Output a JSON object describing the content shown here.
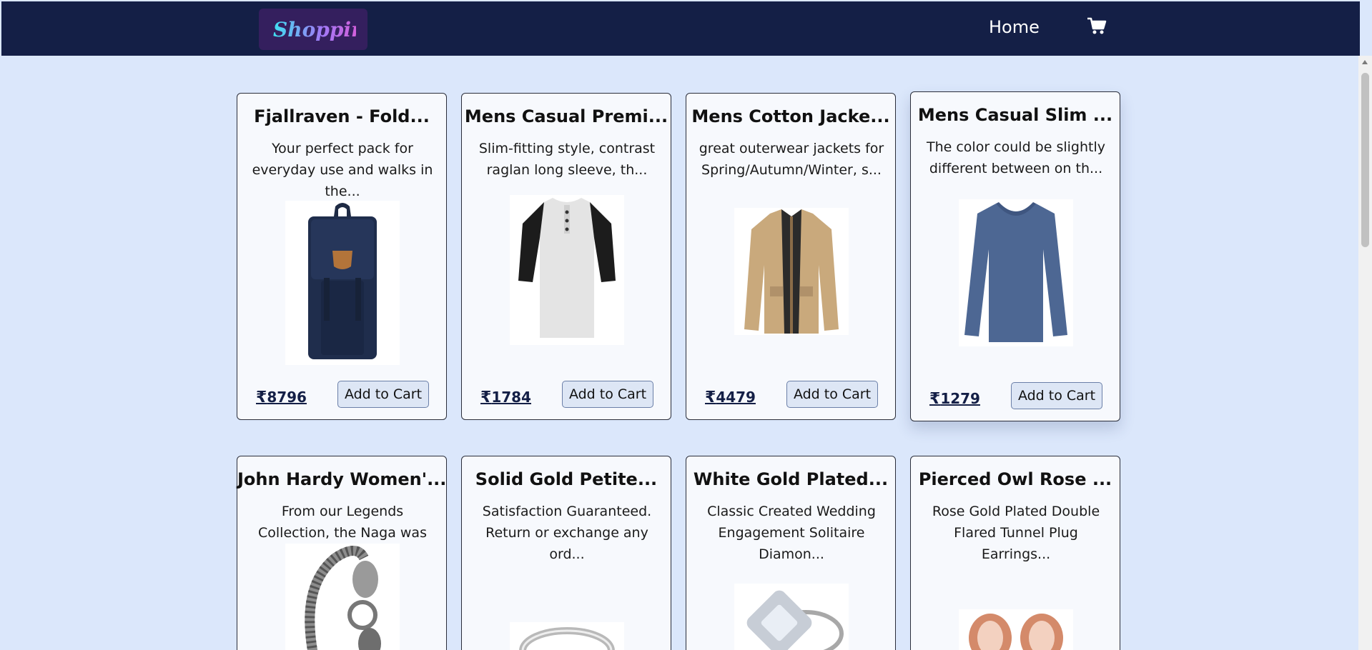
{
  "navbar": {
    "logo_text": "Shopping",
    "home_label": "Home",
    "cart_icon": "shopping-cart-icon",
    "background": "#141f46"
  },
  "products": [
    {
      "title": "Fjallraven - Fold...",
      "description": "Your perfect pack for everyday use and walks in the...",
      "price": "8796",
      "currency": "₹",
      "button": "Add to Cart",
      "icon": "backpack-image"
    },
    {
      "title": "Mens Casual Premi...",
      "description": "Slim-fitting style, contrast raglan long sleeve, th...",
      "price": "1784",
      "currency": "₹",
      "button": "Add to Cart",
      "icon": "raglan-tshirt-image"
    },
    {
      "title": "Mens Cotton Jacke...",
      "description": "great outerwear jackets for Spring/Autumn/Winter, s...",
      "price": "4479",
      "currency": "₹",
      "button": "Add to Cart",
      "icon": "cotton-jacket-image"
    },
    {
      "title": "Mens Casual Slim ...",
      "description": "The color could be slightly different between on th...",
      "price": "1279",
      "currency": "₹",
      "button": "Add to Cart",
      "icon": "slim-fit-shirt-image"
    },
    {
      "title": "John Hardy Women'...",
      "description": "From our Legends Collection, the Naga was inspired ...",
      "icon": "dragon-bracelet-image"
    },
    {
      "title": "Solid Gold Petite...",
      "description": "Satisfaction Guaranteed. Return or exchange any ord...",
      "icon": "gold-ring-image"
    },
    {
      "title": "White Gold Plated...",
      "description": "Classic Created Wedding Engagement Solitaire Diamon...",
      "icon": "diamond-ring-image"
    },
    {
      "title": "Pierced Owl Rose ...",
      "description": "Rose Gold Plated Double Flared Tunnel Plug Earrings...",
      "icon": "rose-gold-plugs-image"
    }
  ]
}
